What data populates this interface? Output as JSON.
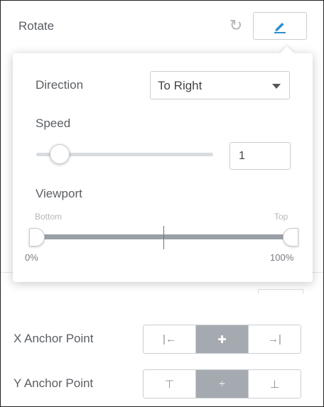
{
  "rotate": {
    "label": "Rotate",
    "reset_icon": "reset-icon",
    "edit_icon": "pencil-icon"
  },
  "popover": {
    "direction": {
      "label": "Direction",
      "value": "To Right"
    },
    "speed": {
      "label": "Speed",
      "value": "1",
      "slider_fraction": 0.1
    },
    "viewport": {
      "label": "Viewport",
      "bottom_label": "Bottom",
      "top_label": "Top",
      "min_label": "0%",
      "max_label": "100%",
      "range": [
        0,
        100
      ]
    }
  },
  "x_anchor": {
    "label": "X Anchor Point",
    "options": [
      {
        "icon": "align-left-icon",
        "glyph": "|←",
        "active": false
      },
      {
        "icon": "align-center-icon",
        "glyph": "✚",
        "active": true
      },
      {
        "icon": "align-right-icon",
        "glyph": "→|",
        "active": false
      }
    ]
  },
  "y_anchor": {
    "label": "Y Anchor Point",
    "options": [
      {
        "icon": "align-top-icon",
        "glyph": "⊤",
        "active": false
      },
      {
        "icon": "align-middle-icon",
        "glyph": "÷",
        "active": true
      },
      {
        "icon": "align-bottom-icon",
        "glyph": "⊥",
        "active": false
      }
    ]
  },
  "colors": {
    "accent": "#2d8fcf",
    "active_segment": "#a4aab0",
    "border": "#c9ced3"
  }
}
